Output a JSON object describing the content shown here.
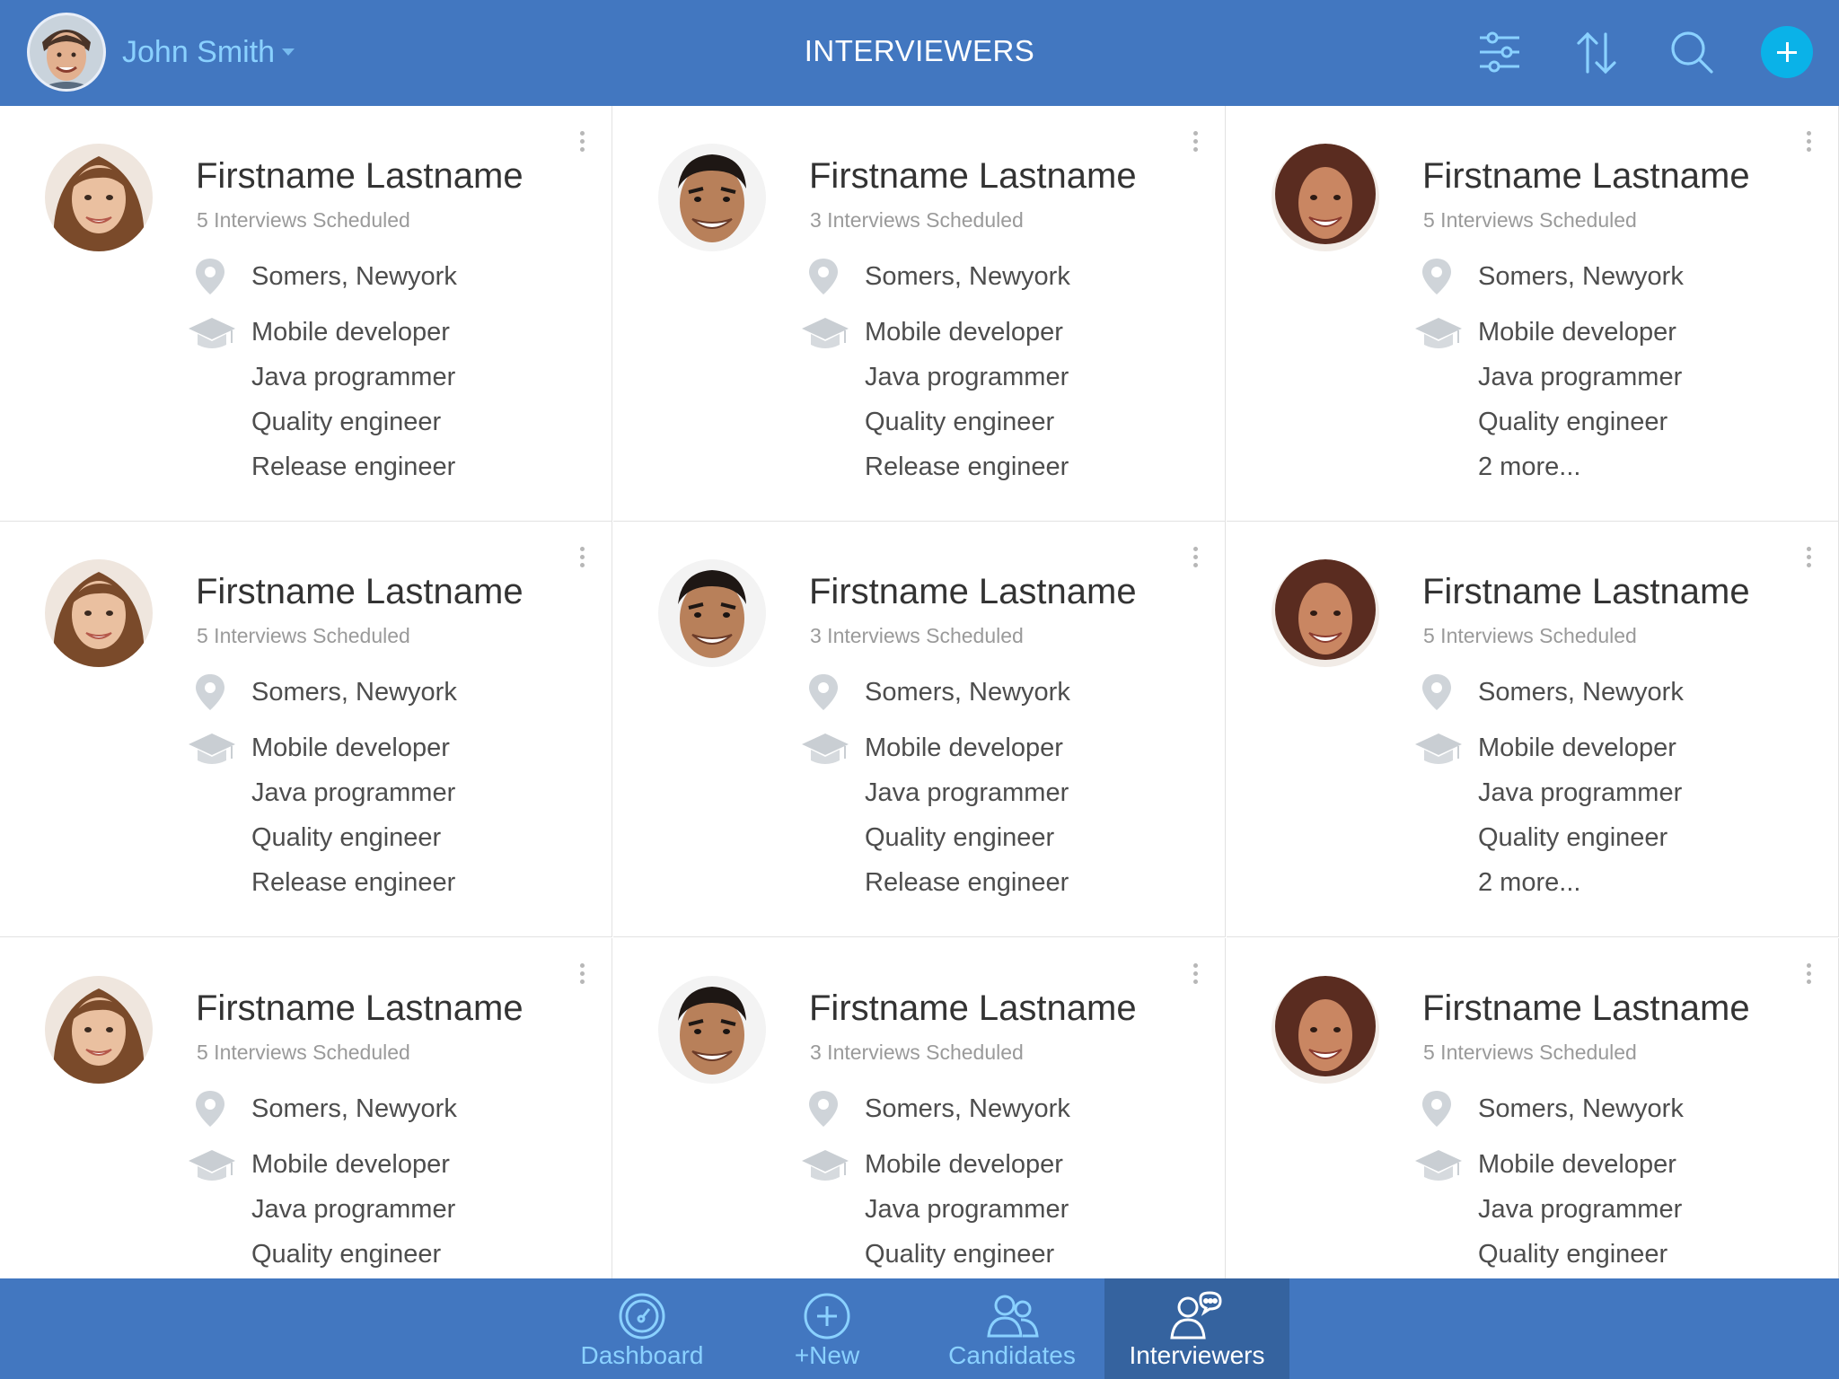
{
  "header": {
    "user_name": "John Smith",
    "title": "INTERVIEWERS",
    "icons": [
      "filter-icon",
      "sort-icon",
      "search-icon",
      "add-icon"
    ]
  },
  "colors": {
    "header_bg": "#4277c0",
    "accent_light_blue": "#8ad1ff",
    "add_button": "#0ab2e8",
    "active_tab_bg": "#35639f"
  },
  "cards": [
    {
      "name": "Firstname Lastname",
      "scheduled": "5 Interviews Scheduled",
      "location": "Somers, Newyork",
      "roles": [
        "Mobile developer",
        "Java programmer",
        "Quality engineer",
        "Release engineer"
      ]
    },
    {
      "name": "Firstname Lastname",
      "scheduled": "3 Interviews Scheduled",
      "location": "Somers, Newyork",
      "roles": [
        "Mobile developer",
        "Java programmer",
        "Quality engineer",
        "Release engineer"
      ]
    },
    {
      "name": "Firstname Lastname",
      "scheduled": "5 Interviews Scheduled",
      "location": "Somers, Newyork",
      "roles": [
        "Mobile developer",
        "Java programmer",
        "Quality engineer",
        "2 more..."
      ]
    },
    {
      "name": "Firstname Lastname",
      "scheduled": "5 Interviews Scheduled",
      "location": "Somers, Newyork",
      "roles": [
        "Mobile developer",
        "Java programmer",
        "Quality engineer",
        "Release engineer"
      ]
    },
    {
      "name": "Firstname Lastname",
      "scheduled": "3 Interviews Scheduled",
      "location": "Somers, Newyork",
      "roles": [
        "Mobile developer",
        "Java programmer",
        "Quality engineer",
        "Release engineer"
      ]
    },
    {
      "name": "Firstname Lastname",
      "scheduled": "5 Interviews Scheduled",
      "location": "Somers, Newyork",
      "roles": [
        "Mobile developer",
        "Java programmer",
        "Quality engineer",
        "2 more..."
      ]
    },
    {
      "name": "Firstname Lastname",
      "scheduled": "5 Interviews Scheduled",
      "location": "Somers, Newyork",
      "roles": [
        "Mobile developer",
        "Java programmer",
        "Quality engineer"
      ]
    },
    {
      "name": "Firstname Lastname",
      "scheduled": "3 Interviews Scheduled",
      "location": "Somers, Newyork",
      "roles": [
        "Mobile developer",
        "Java programmer",
        "Quality engineer"
      ]
    },
    {
      "name": "Firstname Lastname",
      "scheduled": "5 Interviews Scheduled",
      "location": "Somers, Newyork",
      "roles": [
        "Mobile developer",
        "Java programmer",
        "Quality engineer"
      ]
    }
  ],
  "tabs": [
    {
      "label": "Dashboard",
      "icon": "dashboard-icon",
      "active": false
    },
    {
      "label": "+New",
      "icon": "plus-circle-icon",
      "active": false
    },
    {
      "label": "Candidates",
      "icon": "candidates-icon",
      "active": false
    },
    {
      "label": "Interviewers",
      "icon": "interviewers-icon",
      "active": true
    }
  ]
}
